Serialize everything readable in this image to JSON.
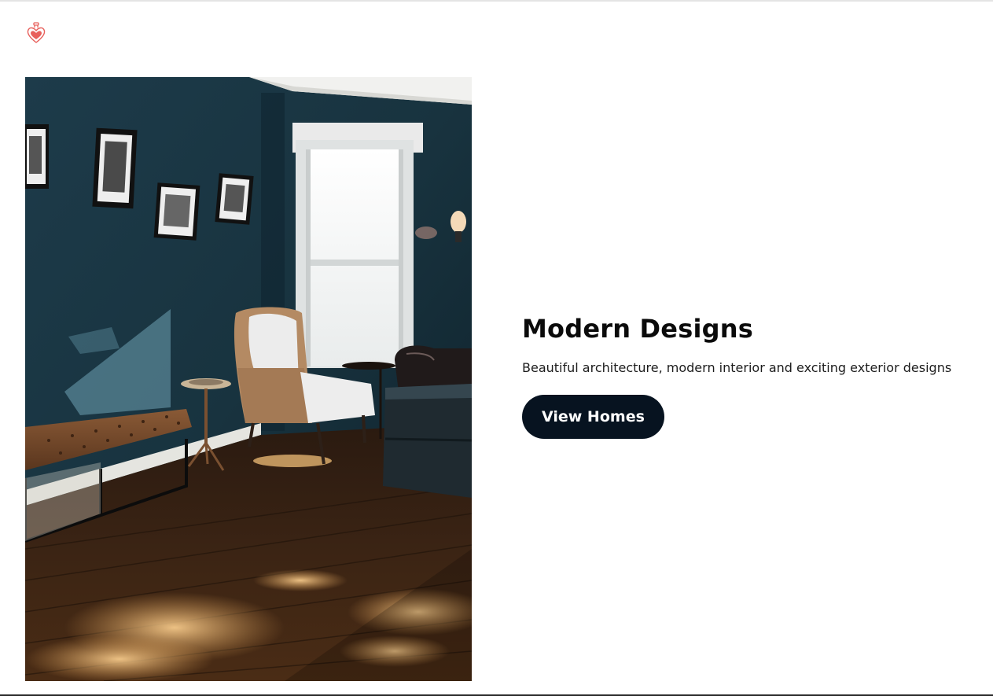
{
  "header": {
    "logo_icon": "heart-potion-icon",
    "accent_color": "#e8605c"
  },
  "hero": {
    "image_icon": "interior-room-photo",
    "title": "Modern Designs",
    "subtitle": "Beautiful architecture, modern interior and exciting exterior designs",
    "cta_label": "View Homes",
    "cta_color": "#071320"
  }
}
